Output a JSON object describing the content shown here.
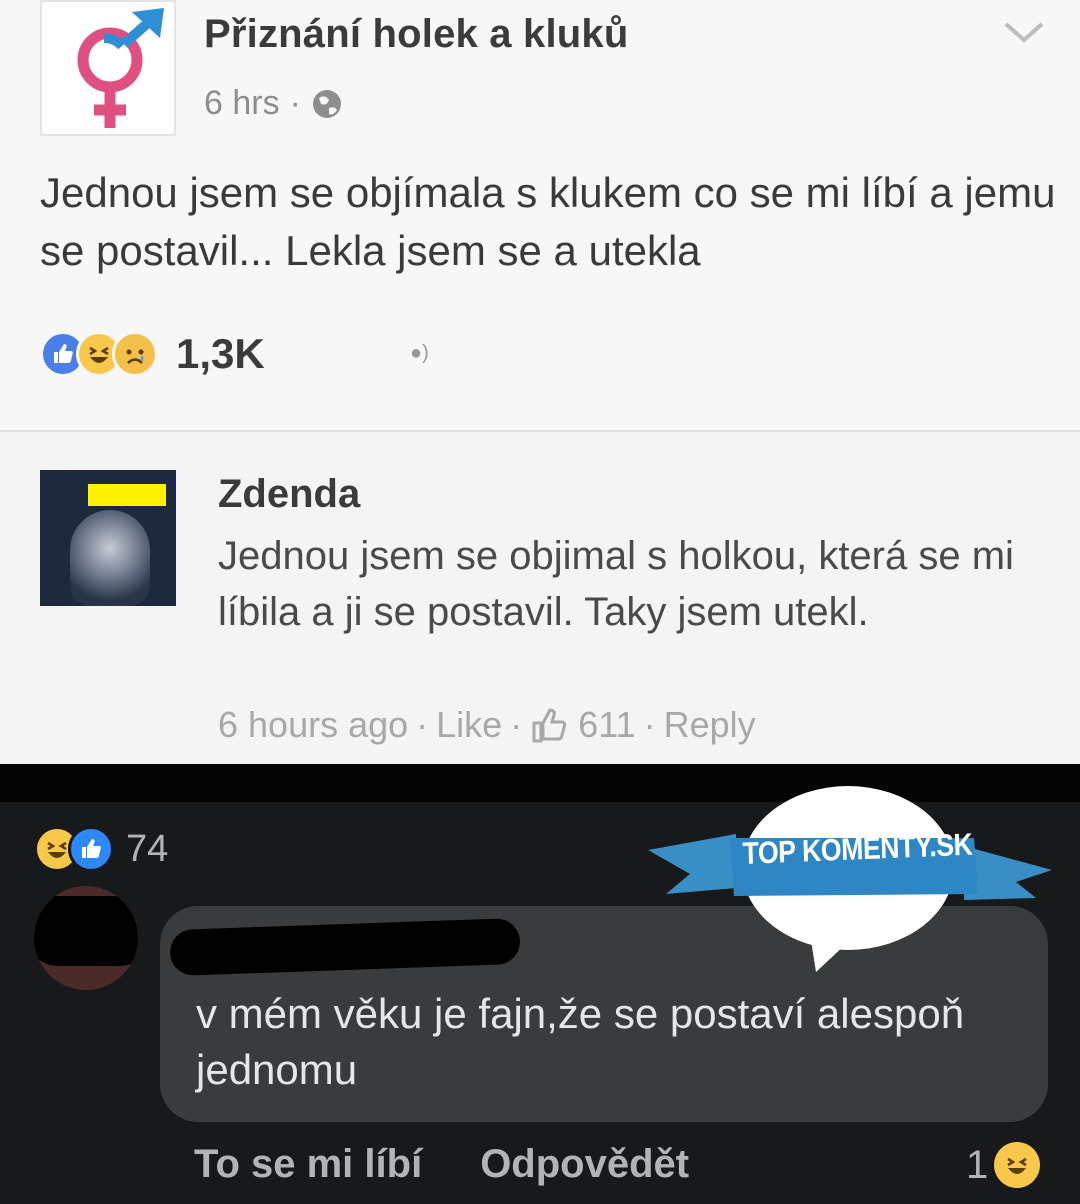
{
  "post": {
    "page_name": "Přiznání holek a kluků",
    "time": "6 hrs",
    "separator": "·",
    "text": "Jednou jsem se objímala s klukem co se mi líbí a jemu se postavil... Lekla jsem se a utekla",
    "reaction_count": "1,3K",
    "reactions": [
      "like",
      "haha",
      "sad"
    ]
  },
  "comment": {
    "author": "Zdenda",
    "text": "Jednou jsem se objimal s holkou, která se mi líbila a ji se postavil. Taky jsem utekl.",
    "time": "6 hours ago",
    "like_label": "Like",
    "like_count": "611",
    "reply_label": "Reply",
    "separator": "·"
  },
  "dark_comment": {
    "reaction_count": "74",
    "text": "v mém věku je fajn,že se postaví alespoň jednomu",
    "like_action": "To se mi líbí",
    "reply_action": "Odpovědět",
    "reply_reaction_count": "1"
  },
  "watermark": {
    "text": "TOP KOMENTY.SK"
  },
  "colors": {
    "like_blue": "#4a7ee8",
    "haha_yellow": "#f7c84a",
    "dark_bg": "#18191a",
    "bubble_bg": "#3a3b3c"
  }
}
